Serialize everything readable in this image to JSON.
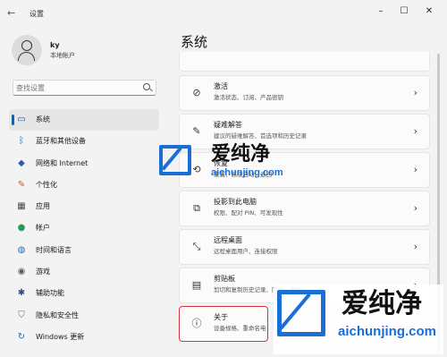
{
  "window": {
    "back_icon": "back-arrow-icon",
    "title": "设置",
    "controls": [
      "minimize",
      "maximize",
      "close"
    ]
  },
  "profile": {
    "name": "ky",
    "account_type": "本地帐户"
  },
  "search": {
    "placeholder": "查找设置"
  },
  "nav": {
    "items": [
      {
        "label": "系统",
        "icon": "display-icon",
        "active": true
      },
      {
        "label": "蓝牙和其他设备",
        "icon": "bluetooth-icon"
      },
      {
        "label": "网络和 Internet",
        "icon": "wifi-icon"
      },
      {
        "label": "个性化",
        "icon": "brush-icon"
      },
      {
        "label": "应用",
        "icon": "apps-icon"
      },
      {
        "label": "帐户",
        "icon": "account-icon"
      },
      {
        "label": "时间和语言",
        "icon": "globe-clock-icon"
      },
      {
        "label": "游戏",
        "icon": "gamepad-icon"
      },
      {
        "label": "辅助功能",
        "icon": "accessibility-icon"
      },
      {
        "label": "隐私和安全性",
        "icon": "shield-icon"
      },
      {
        "label": "Windows 更新",
        "icon": "update-icon"
      }
    ]
  },
  "main": {
    "title": "系统",
    "cards": [
      {
        "title": "激活",
        "desc": "激活状态、订阅、产品密钥",
        "icon": "check-circle-icon"
      },
      {
        "title": "疑难解答",
        "desc": "建议的疑难解答、首选项和历史记录",
        "icon": "wrench-icon"
      },
      {
        "title": "恢复",
        "desc": "重置、高级启动、返回",
        "icon": "recovery-icon"
      },
      {
        "title": "投影到此电脑",
        "desc": "权限、配对 PIN、可发现性",
        "icon": "project-icon"
      },
      {
        "title": "远程桌面",
        "desc": "远程桌面用户、连接权限",
        "icon": "remote-desktop-icon"
      },
      {
        "title": "剪贴板",
        "desc": "剪切和复制历史记录、同步、清除",
        "icon": "clipboard-icon"
      },
      {
        "title": "关于",
        "desc": "设备规格、重命名电脑、Windows 规格",
        "icon": "info-icon"
      }
    ]
  },
  "watermark": {
    "brand": "爱纯净",
    "url": "aichunjing.com",
    "color": "#1a6fd6"
  }
}
